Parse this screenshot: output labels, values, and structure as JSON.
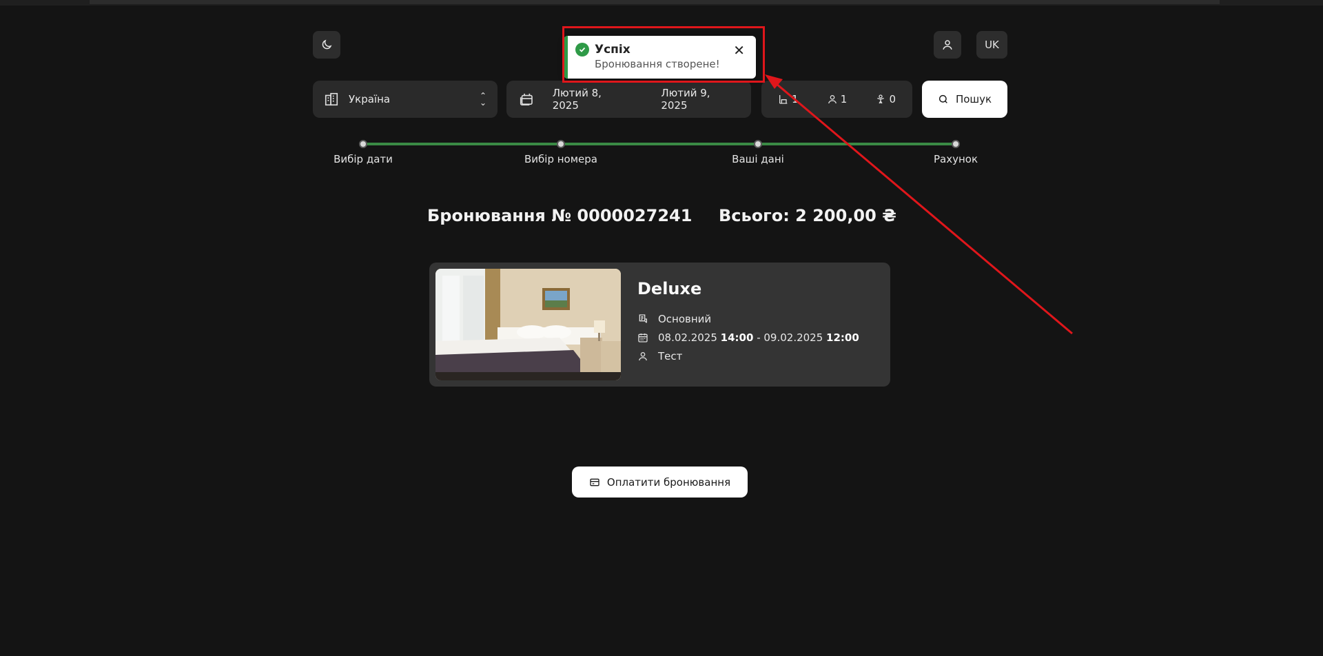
{
  "header": {
    "language_label": "UK"
  },
  "search": {
    "location": "Україна",
    "date_from": "Лютий 8, 2025",
    "date_to": "Лютий 9, 2025",
    "rooms_count": "1",
    "adults_count": "1",
    "children_count": "0",
    "search_label": "Пошук"
  },
  "steps": [
    {
      "label": "Вибір дати"
    },
    {
      "label": "Вибір номера"
    },
    {
      "label": "Ваші дані"
    },
    {
      "label": "Рахунок"
    }
  ],
  "booking": {
    "number_label": "Бронювання № 0000027241",
    "total_label": "Всього: 2 200,00 ₴"
  },
  "room": {
    "title": "Deluxe",
    "rate": "Основний",
    "date_from": "08.02.2025",
    "time_from": "14:00",
    "separator": " - ",
    "date_to": "09.02.2025",
    "time_to": "12:00",
    "guest": "Тест"
  },
  "pay_button_label": "Оплатити бронювання",
  "toast": {
    "title": "Успіх",
    "message": "Бронювання створене!",
    "accent_color": "#2e9a47"
  },
  "annotation_color": "#e0161b",
  "icons": {
    "theme": "moon-icon",
    "user": "user-icon",
    "location": "building-icon",
    "calendar": "calendar-icon",
    "rooms": "bed-icon",
    "adults": "user-icon",
    "children": "child-icon",
    "search": "search-icon",
    "rate": "receipt-icon",
    "dates": "calendar-icon",
    "guest": "user-icon",
    "pay": "card-icon",
    "success": "check-circle-icon",
    "close": "close-icon"
  }
}
